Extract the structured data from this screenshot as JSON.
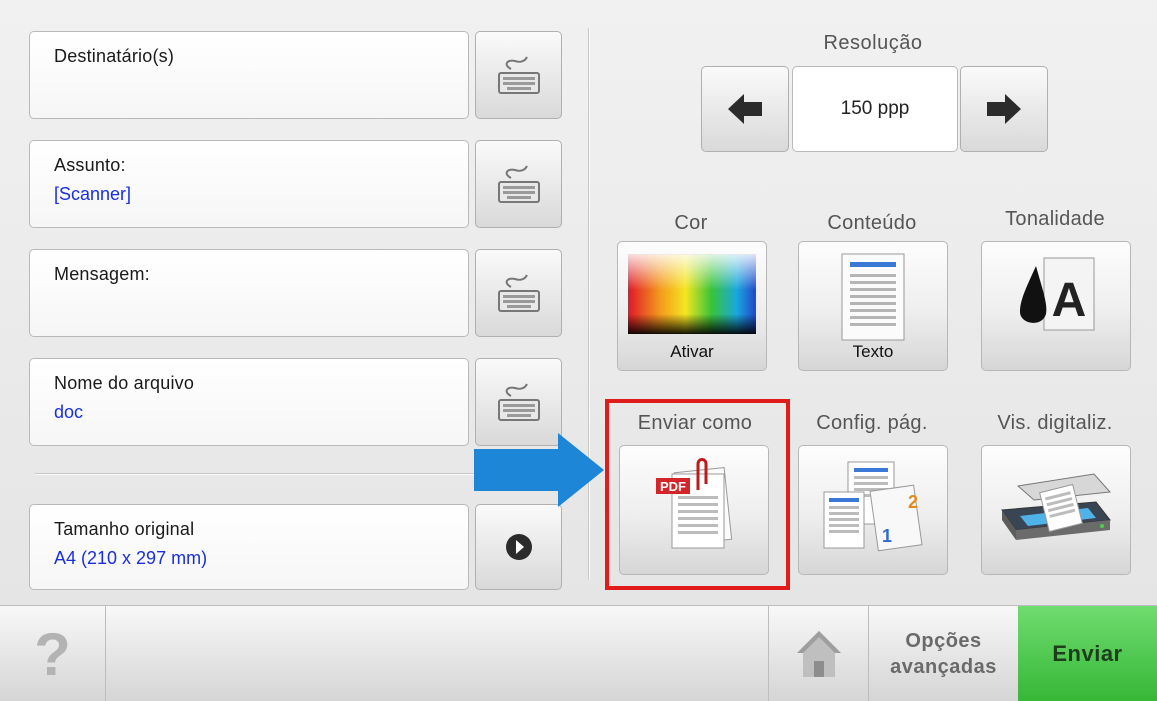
{
  "fields": [
    {
      "label": "Destinatário(s)",
      "value": ""
    },
    {
      "label": "Assunto:",
      "value": "[Scanner]"
    },
    {
      "label": "Mensagem:",
      "value": ""
    },
    {
      "label": "Nome do arquivo",
      "value": "doc"
    }
  ],
  "original_size": {
    "label": "Tamanho original",
    "value": "A4 (210 x 297 mm)"
  },
  "resolution": {
    "title": "Resolução",
    "value": "150 ppp"
  },
  "tiles": {
    "color": {
      "label": "Cor",
      "caption": "Ativar"
    },
    "content": {
      "label": "Conteúdo",
      "caption": "Texto"
    },
    "darkness": {
      "label": "Tonalidade"
    },
    "send_as": {
      "label": "Enviar como",
      "icon_text": "PDF"
    },
    "page_setup": {
      "label": "Config. pág."
    },
    "scan_preview": {
      "label": "Vis. digitaliz."
    }
  },
  "bottom": {
    "help": "?",
    "advanced_line1": "Opções",
    "advanced_line2": "avançadas",
    "send": "Enviar"
  },
  "colors": {
    "accent_value": "#1a2fe0",
    "highlight": "#e21b1b",
    "send_green": "#4cc94c",
    "pointer_blue": "#1e86d6"
  },
  "icons": [
    "keyboard-icon",
    "left-arrow-icon",
    "right-arrow-icon",
    "right-circle-arrow-icon",
    "color-spectrum-icon",
    "text-document-icon",
    "darkness-icon",
    "pdf-document-icon",
    "page-setup-icon",
    "scanner-icon",
    "home-icon",
    "help-icon",
    "blue-pointer-arrow"
  ]
}
